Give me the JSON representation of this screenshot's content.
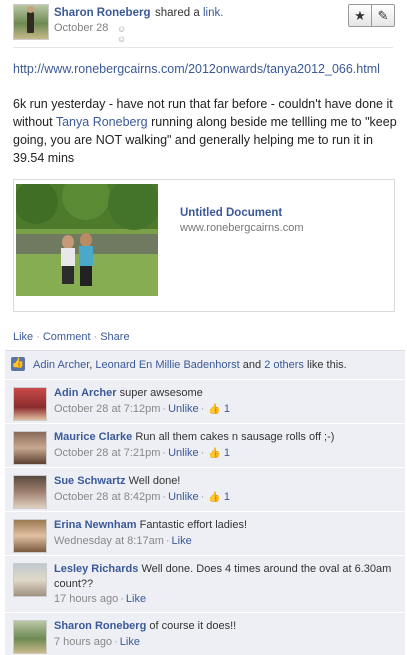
{
  "post": {
    "author": "Sharon Roneberg",
    "shared_text": "shared a",
    "shared_link_label": "link.",
    "date": "October 28",
    "audience_icon": "people-icon",
    "url": "http://www.ronebergcairns.com/2012onwards/tanya2012_066.html",
    "text_part1": "6k run yesterday - have not run that far before - couldn't have done it without",
    "mention": "Tanya Roneberg",
    "text_part2": "running along beside me tellling me to \"keep going, you are NOT walking\" and generally helping me to run it in 39.54 mins",
    "star_icon": "star-icon",
    "edit_icon": "pencil-icon"
  },
  "attachment": {
    "title": "Untitled Document",
    "domain": "www.ronebergcairns.com"
  },
  "actions": {
    "like": "Like",
    "comment": "Comment",
    "share": "Share"
  },
  "likes": {
    "person1": "Adin Archer",
    "person2": "Leonard En Millie Badenhorst",
    "and": "and",
    "others": "2 others",
    "suffix": "like this."
  },
  "comments": [
    {
      "author": "Adin Archer",
      "text": "super awsesome",
      "time": "October 28 at 7:12pm",
      "unlike": "Unlike",
      "likes": "1"
    },
    {
      "author": "Maurice Clarke",
      "text": "Run all them cakes n sausage rolls off ;-)",
      "time": "October 28 at 7:21pm",
      "unlike": "Unlike",
      "likes": "1"
    },
    {
      "author": "Sue Schwartz",
      "text": "Well done!",
      "time": "October 28 at 8:42pm",
      "unlike": "Unlike",
      "likes": "1"
    },
    {
      "author": "Erina Newnham",
      "text": "Fantastic effort ladies!",
      "time": "Wednesday at 8:17am",
      "like": "Like"
    },
    {
      "author": "Lesley Richards",
      "text": "Well done. Does 4 times around the oval at 6.30am count??",
      "time": "17 hours ago",
      "like": "Like"
    },
    {
      "author": "Sharon Roneberg",
      "text": "of course it does!!",
      "time": "7 hours ago",
      "like": "Like"
    }
  ]
}
